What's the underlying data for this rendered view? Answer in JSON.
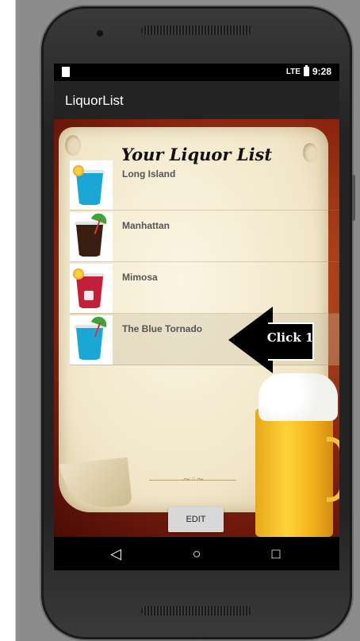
{
  "status_bar": {
    "time": "9:28",
    "signal": "LTE"
  },
  "app_bar": {
    "title": "LiquorList"
  },
  "list": {
    "title": "Your Liquor List",
    "items": [
      {
        "label": "Long Island",
        "icon": "blue-cocktail-icon",
        "color": "#1aa7d6"
      },
      {
        "label": "Manhattan",
        "icon": "brown-cocktail-icon",
        "color": "#3b1e12"
      },
      {
        "label": "Mimosa",
        "icon": "red-cocktail-icon",
        "color": "#c21f3a"
      },
      {
        "label": "The Blue Tornado",
        "icon": "blue-cocktail-icon",
        "color": "#1aa7d6"
      }
    ]
  },
  "annotation": {
    "text": "Click 1"
  },
  "edit_button": {
    "label": "EDIT"
  },
  "nav": {
    "back": "◁",
    "home": "○",
    "recents": "□"
  }
}
